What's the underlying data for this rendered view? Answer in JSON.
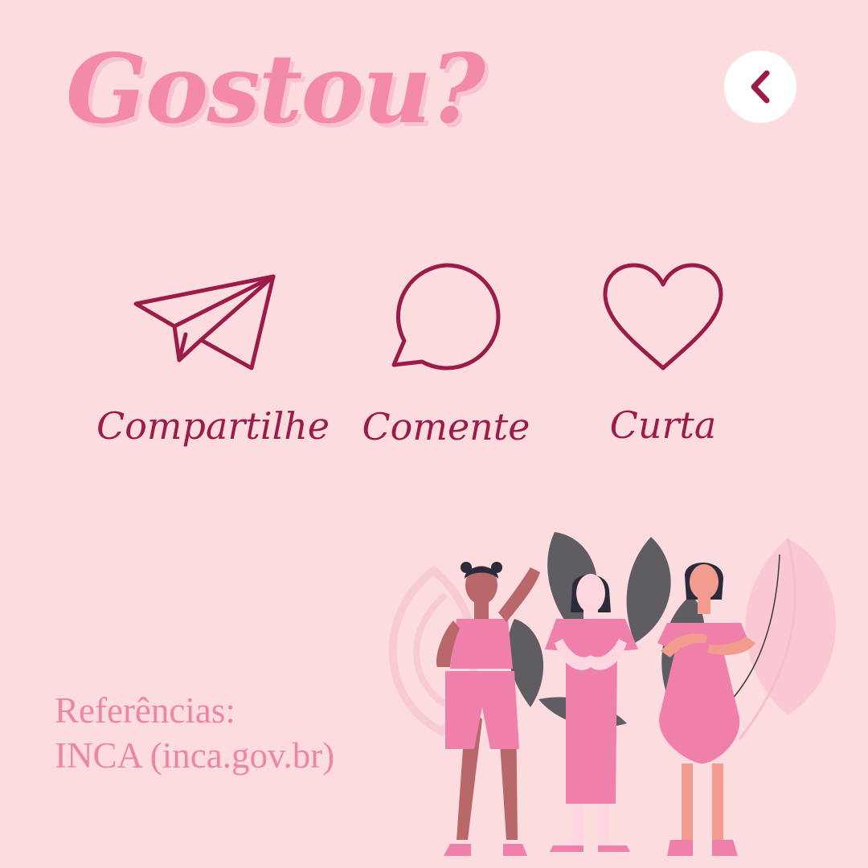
{
  "header": {
    "title": "Gostou?",
    "back_icon": "chevron-left-icon"
  },
  "actions": [
    {
      "icon": "paper-plane-icon",
      "label": "Compartilhe"
    },
    {
      "icon": "speech-bubble-icon",
      "label": "Comente"
    },
    {
      "icon": "heart-icon",
      "label": "Curta"
    }
  ],
  "references": {
    "heading": "Referências:",
    "source": "INCA (inca.gov.br)"
  },
  "colors": {
    "background": "#fddcdf",
    "title": "#f28aa8",
    "accent": "#9c1c49",
    "references": "#ec86a6"
  }
}
